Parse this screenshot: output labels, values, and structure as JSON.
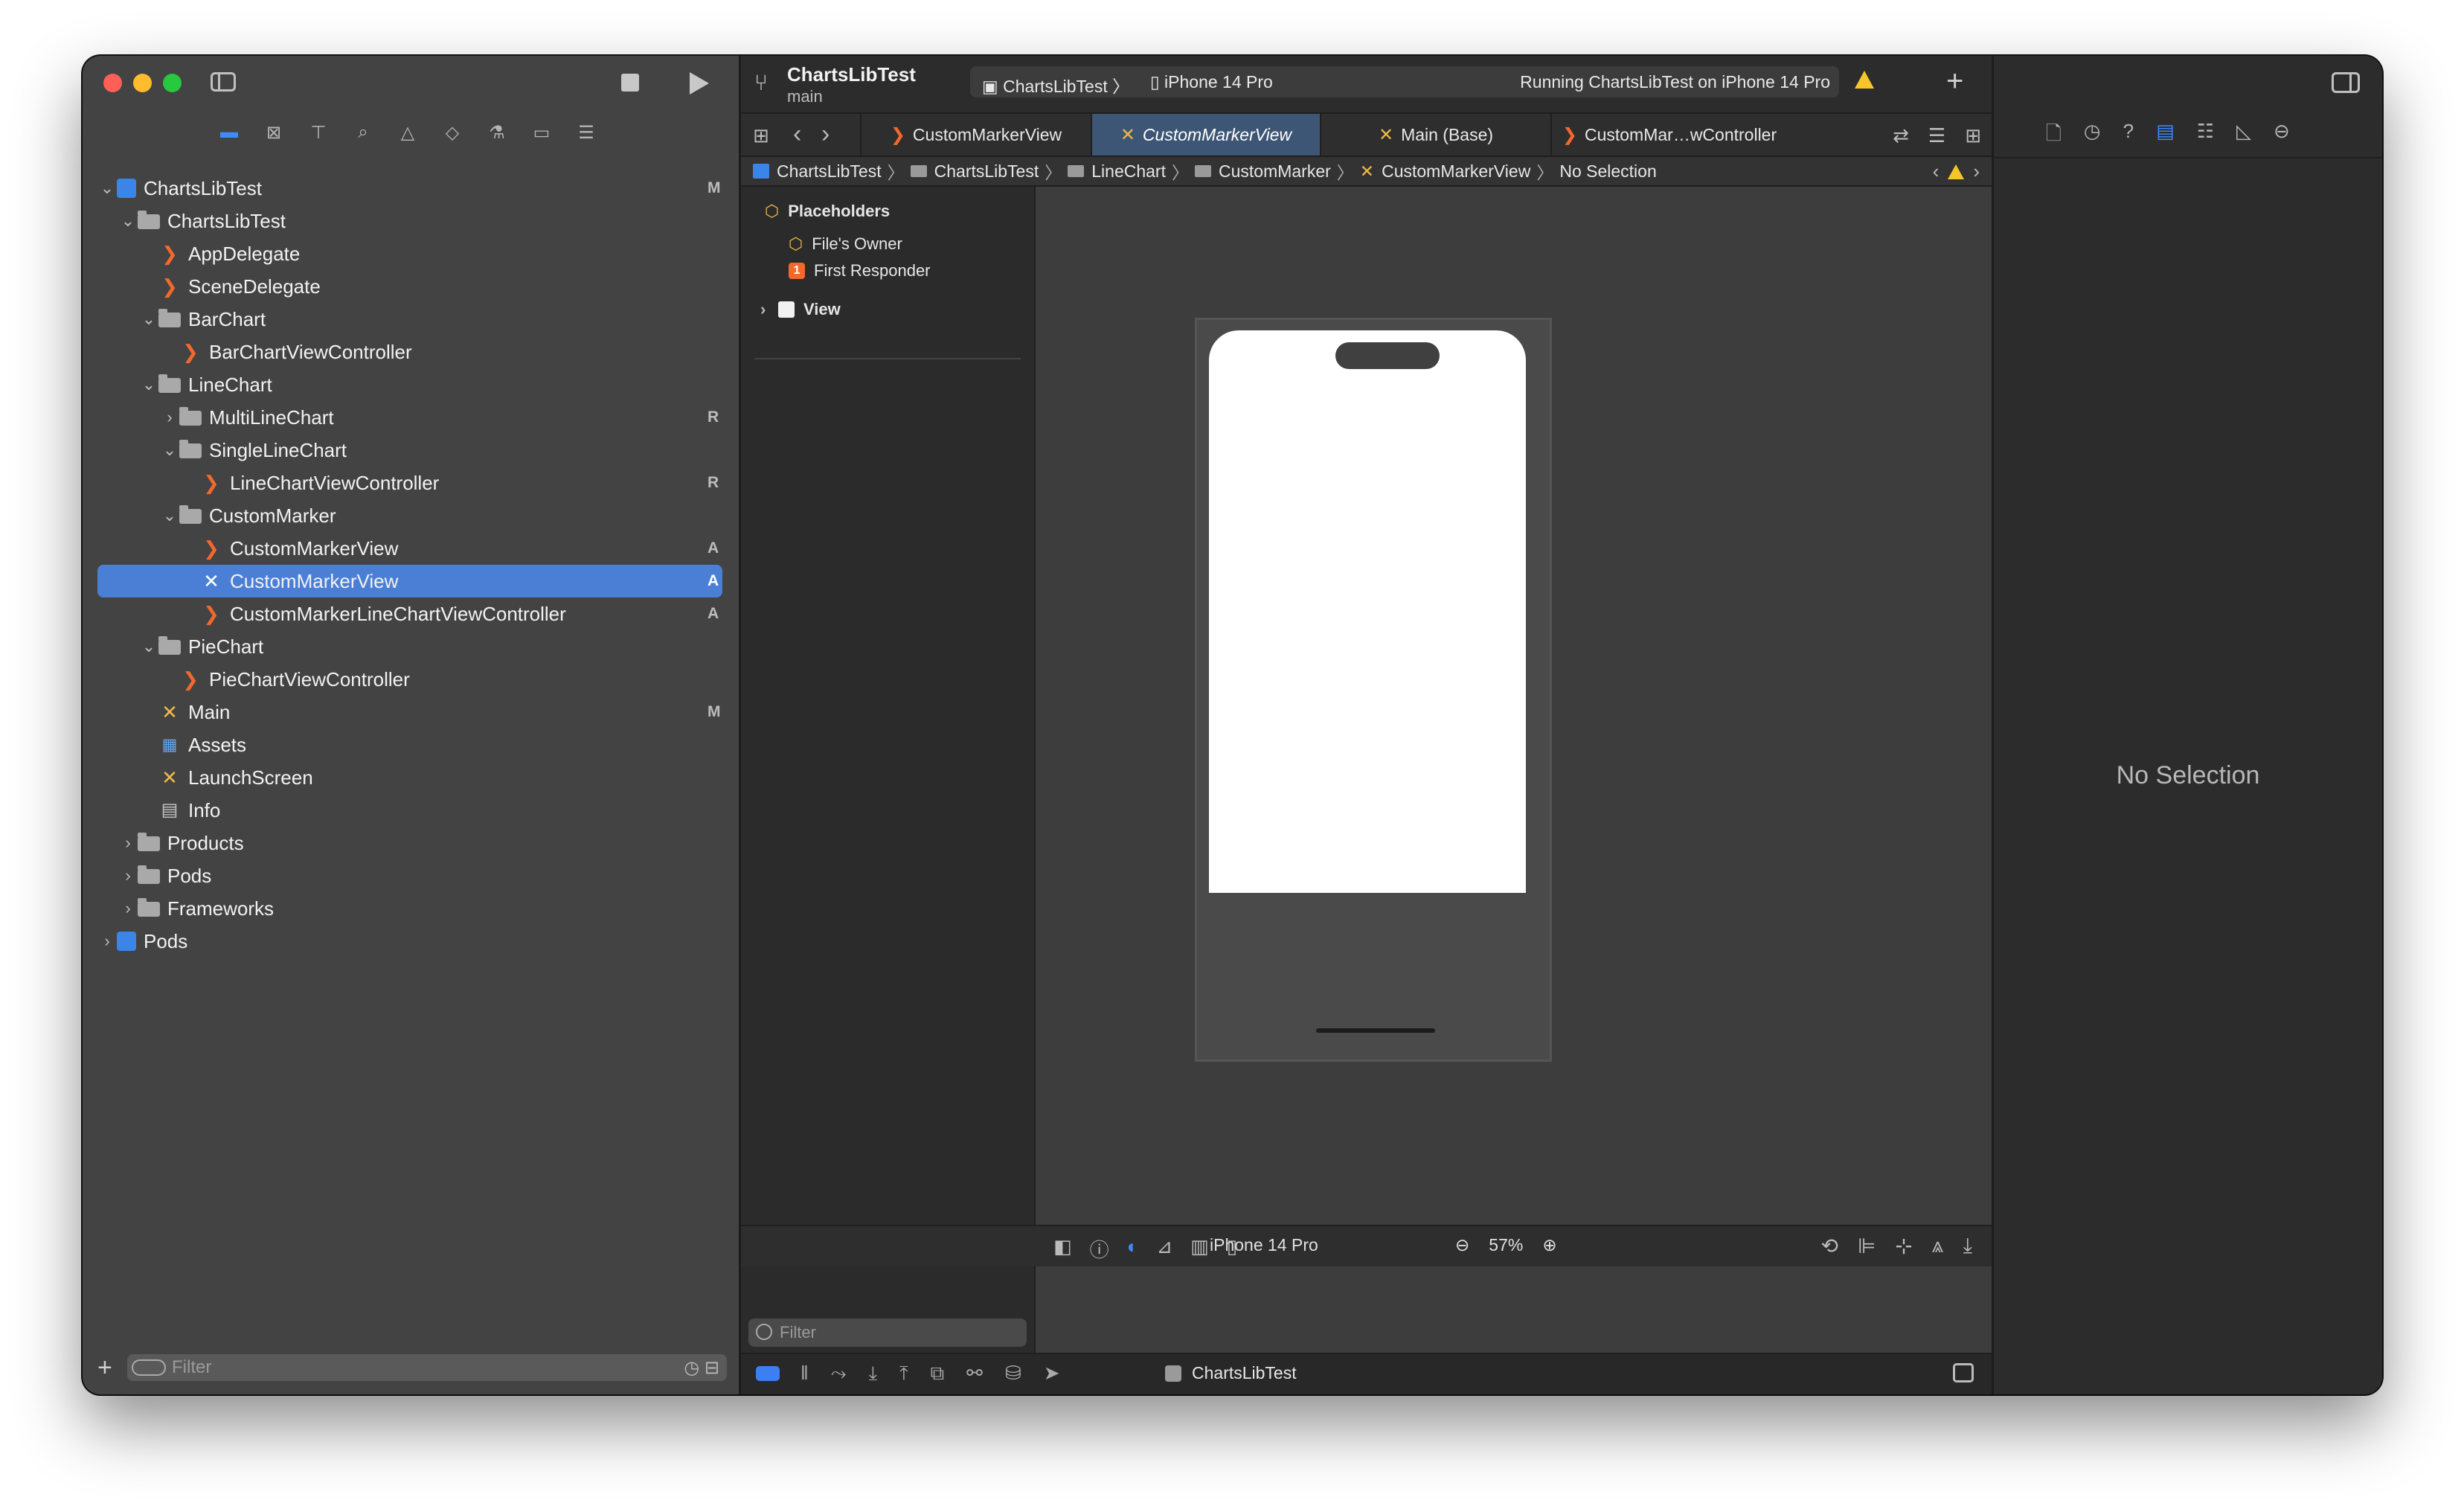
{
  "window": {
    "project_title": "ChartsLibTest",
    "branch": "main"
  },
  "navigator": {
    "tabs": [
      "folder-icon",
      "x-square-icon",
      "hierarchy-icon",
      "search-icon",
      "warning-icon",
      "diamond-icon",
      "test-icon",
      "breakpoint-icon",
      "report-icon"
    ],
    "filter_placeholder": "Filter",
    "tree": [
      {
        "label": "ChartsLibTest",
        "depth": 0,
        "icon": "project",
        "chev": "v",
        "badge": "M"
      },
      {
        "label": "ChartsLibTest",
        "depth": 1,
        "icon": "folder",
        "chev": "v",
        "badge": ""
      },
      {
        "label": "AppDelegate",
        "depth": 2,
        "icon": "swift",
        "chev": "",
        "badge": ""
      },
      {
        "label": "SceneDelegate",
        "depth": 2,
        "icon": "swift",
        "chev": "",
        "badge": ""
      },
      {
        "label": "BarChart",
        "depth": 2,
        "icon": "folder",
        "chev": "v",
        "badge": ""
      },
      {
        "label": "BarChartViewController",
        "depth": 3,
        "icon": "swift",
        "chev": "",
        "badge": ""
      },
      {
        "label": "LineChart",
        "depth": 2,
        "icon": "folder",
        "chev": "v",
        "badge": ""
      },
      {
        "label": "MultiLineChart",
        "depth": 3,
        "icon": "folder",
        "chev": ">",
        "badge": "R"
      },
      {
        "label": "SingleLineChart",
        "depth": 3,
        "icon": "folder",
        "chev": "v",
        "badge": ""
      },
      {
        "label": "LineChartViewController",
        "depth": 4,
        "icon": "swift",
        "chev": "",
        "badge": "R"
      },
      {
        "label": "CustomMarker",
        "depth": 3,
        "icon": "folder",
        "chev": "v",
        "badge": ""
      },
      {
        "label": "CustomMarkerView",
        "depth": 4,
        "icon": "swift",
        "chev": "",
        "badge": "A"
      },
      {
        "label": "CustomMarkerView",
        "depth": 4,
        "icon": "xib",
        "chev": "",
        "badge": "A",
        "selected": true
      },
      {
        "label": "CustomMarkerLineChartViewController",
        "depth": 4,
        "icon": "swift",
        "chev": "",
        "badge": "A"
      },
      {
        "label": "PieChart",
        "depth": 2,
        "icon": "folder",
        "chev": "v",
        "badge": ""
      },
      {
        "label": "PieChartViewController",
        "depth": 3,
        "icon": "swift",
        "chev": "",
        "badge": ""
      },
      {
        "label": "Main",
        "depth": 2,
        "icon": "xib",
        "chev": "",
        "badge": "M"
      },
      {
        "label": "Assets",
        "depth": 2,
        "icon": "assets",
        "chev": "",
        "badge": ""
      },
      {
        "label": "LaunchScreen",
        "depth": 2,
        "icon": "xib",
        "chev": "",
        "badge": ""
      },
      {
        "label": "Info",
        "depth": 2,
        "icon": "info",
        "chev": "",
        "badge": ""
      },
      {
        "label": "Products",
        "depth": 1,
        "icon": "folder",
        "chev": ">",
        "badge": ""
      },
      {
        "label": "Pods",
        "depth": 1,
        "icon": "folder",
        "chev": ">",
        "badge": ""
      },
      {
        "label": "Frameworks",
        "depth": 1,
        "icon": "folder",
        "chev": ">",
        "badge": ""
      },
      {
        "label": "Pods",
        "depth": 0,
        "icon": "project",
        "chev": ">",
        "badge": ""
      }
    ]
  },
  "toolbar": {
    "scheme_project": "ChartsLibTest",
    "scheme_device": "iPhone 14 Pro",
    "status": "Running ChartsLibTest on iPhone 14 Pro"
  },
  "tabs": [
    {
      "label": "CustomMarkerView",
      "icon": "swift",
      "active": false
    },
    {
      "label": "CustomMarkerView",
      "icon": "xib",
      "active": true
    },
    {
      "label": "Main (Base)",
      "icon": "xib",
      "active": false
    },
    {
      "label": "CustomMar…wController",
      "icon": "swift",
      "active": false
    }
  ],
  "jumpbar": [
    "ChartsLibTest",
    "ChartsLibTest",
    "LineChart",
    "CustomMarker",
    "CustomMarkerView",
    "No Selection"
  ],
  "outline": {
    "placeholders": "Placeholders",
    "files_owner": "File's Owner",
    "first_responder": "First Responder",
    "first_responder_badge": "1",
    "view": "View",
    "filter_placeholder": "Filter"
  },
  "canvas_bar": {
    "device": "iPhone 14 Pro",
    "zoom": "57%"
  },
  "debug_bar": {
    "project": "ChartsLibTest"
  },
  "inspector": {
    "empty_message": "No Selection"
  }
}
